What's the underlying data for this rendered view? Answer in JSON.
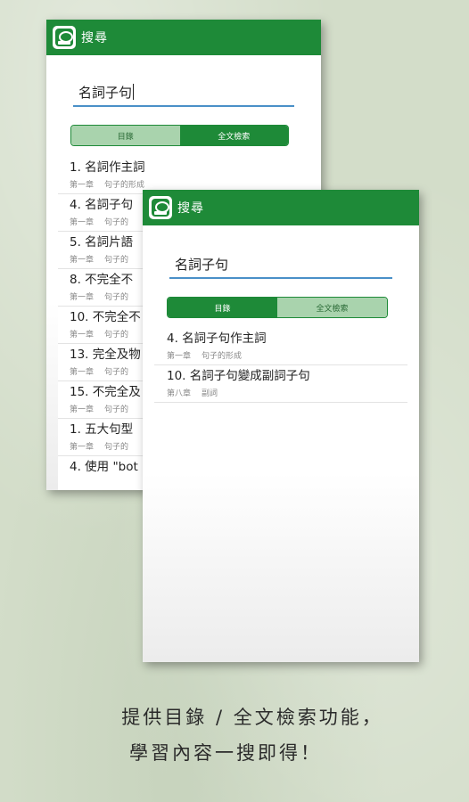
{
  "back_screen": {
    "title": "搜尋",
    "search_value": "名詞子句",
    "tabs": [
      "目錄",
      "全文檢索"
    ],
    "results": [
      {
        "title": "1. 名詞作主詞",
        "chapter": "第一章",
        "section": "句子的形成"
      },
      {
        "title": "4. 名詞子句",
        "chapter": "第一章",
        "section": "句子的"
      },
      {
        "title": "5. 名詞片語",
        "chapter": "第一章",
        "section": "句子的"
      },
      {
        "title": "8. 不完全不",
        "chapter": "第一章",
        "section": "句子的"
      },
      {
        "title": "10. 不完全不",
        "chapter": "第一章",
        "section": "句子的"
      },
      {
        "title": "13. 完全及物",
        "chapter": "第一章",
        "section": "句子的"
      },
      {
        "title": "15. 不完全及",
        "chapter": "第一章",
        "section": "句子的"
      },
      {
        "title": "1. 五大句型",
        "chapter": "第一章",
        "section": "句子的"
      },
      {
        "title": "4. 使用 \"bot",
        "chapter": "",
        "section": ""
      }
    ]
  },
  "front_screen": {
    "title": "搜尋",
    "search_value": "名詞子句",
    "tabs": [
      "目錄",
      "全文檢索"
    ],
    "results": [
      {
        "title": "4. 名詞子句作主詞",
        "chapter": "第一章",
        "section": "句子的形成"
      },
      {
        "title": "10. 名詞子句變成副詞子句",
        "chapter": "第八章",
        "section": "副詞"
      }
    ]
  },
  "caption": {
    "line1": "提供目錄 / 全文檢索功能，",
    "line2": "學習內容一搜即得！"
  },
  "colors": {
    "appbar": "#1e8a38",
    "segment_active": "#1e8a38",
    "segment_inactive": "#a9d3ad",
    "search_underline": "#4a90c8",
    "background": "#d3ddc9"
  }
}
